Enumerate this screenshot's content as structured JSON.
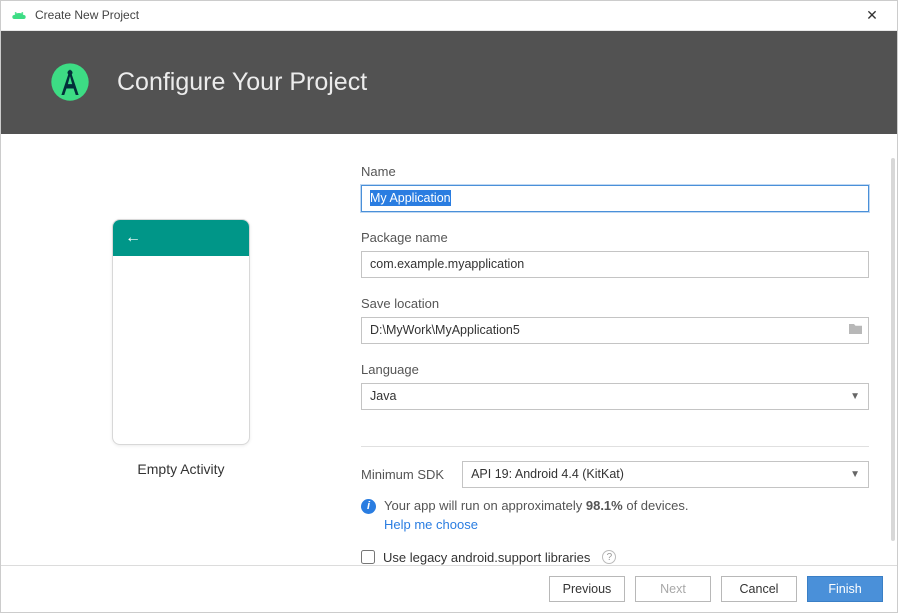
{
  "window": {
    "title": "Create New Project"
  },
  "header": {
    "heading": "Configure Your Project"
  },
  "preview": {
    "label": "Empty Activity"
  },
  "form": {
    "name": {
      "label": "Name",
      "value": "My Application"
    },
    "package": {
      "label": "Package name",
      "value": "com.example.myapplication"
    },
    "save_location": {
      "label": "Save location",
      "value": "D:\\MyWork\\MyApplication5"
    },
    "language": {
      "label": "Language",
      "value": "Java"
    },
    "min_sdk": {
      "label": "Minimum SDK",
      "value": "API 19: Android 4.4 (KitKat)"
    },
    "info": {
      "prefix": "Your app will run on approximately ",
      "percent": "98.1%",
      "suffix": " of devices.",
      "help_link": "Help me choose"
    },
    "legacy": {
      "label": "Use legacy android.support libraries",
      "checked": false
    }
  },
  "footer": {
    "previous": "Previous",
    "next": "Next",
    "cancel": "Cancel",
    "finish": "Finish"
  }
}
